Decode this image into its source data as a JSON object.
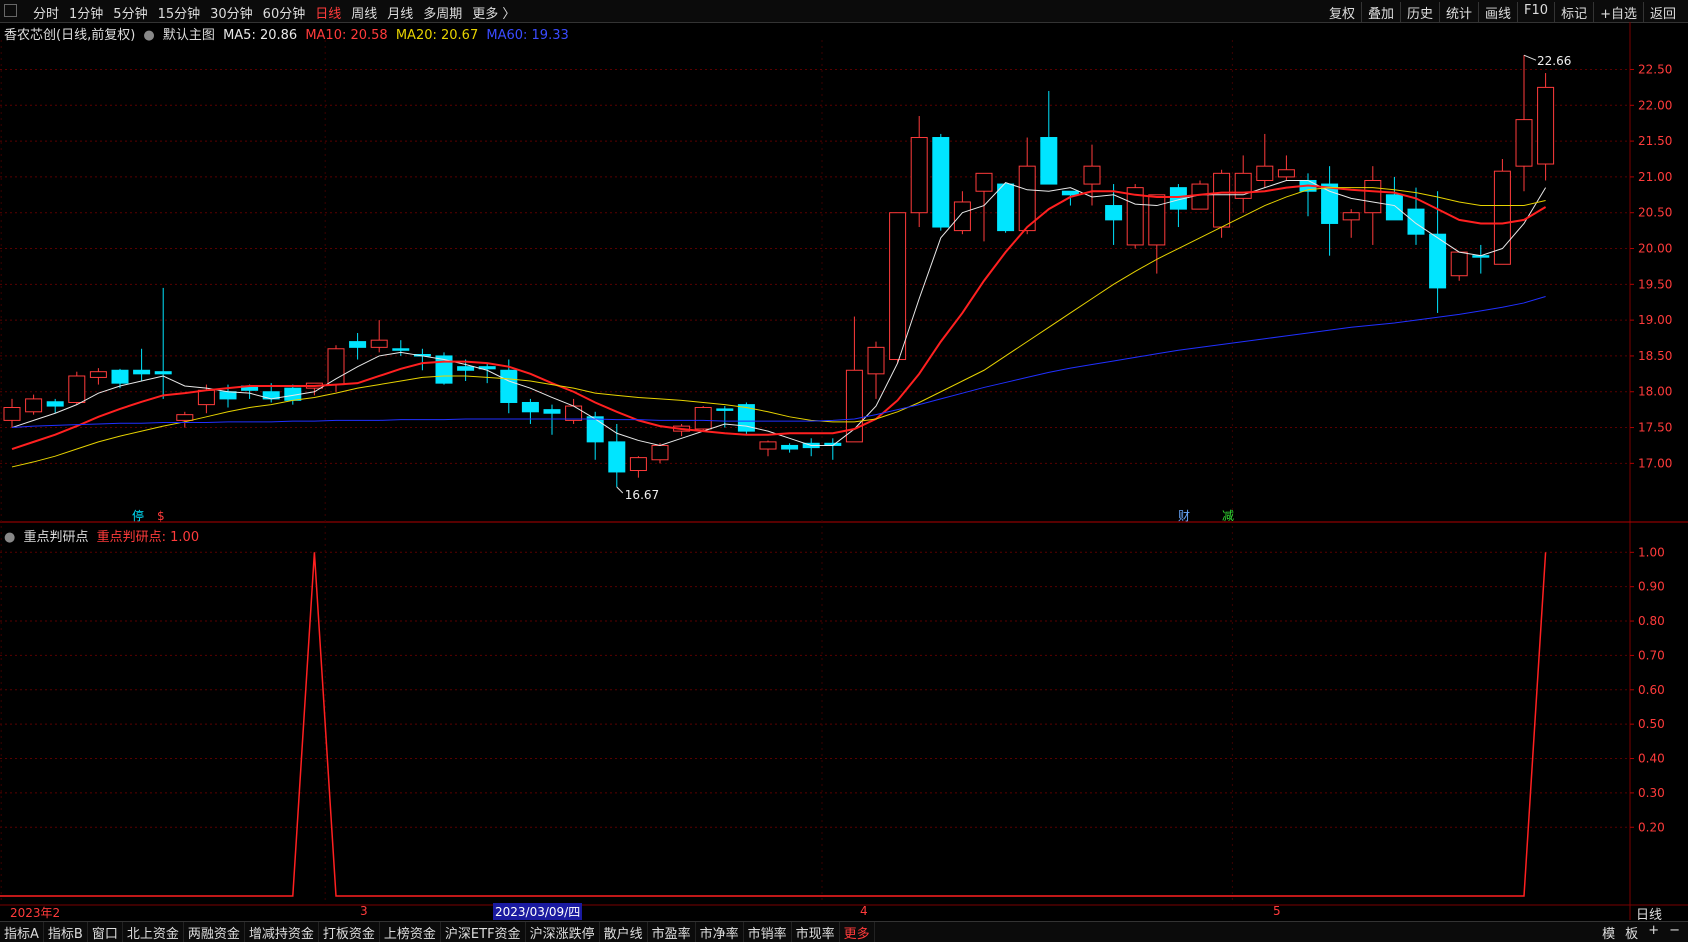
{
  "topbar": {
    "tabs": [
      "分时",
      "1分钟",
      "5分钟",
      "15分钟",
      "30分钟",
      "60分钟",
      "日线",
      "周线",
      "月线",
      "多周期",
      "更多 〉"
    ],
    "active_tab": "日线",
    "right_buttons": [
      "复权",
      "叠加",
      "历史",
      "统计",
      "画线",
      "F10",
      "标记",
      "+自选",
      "返回"
    ]
  },
  "main_legend": {
    "title": "香农芯创(日线,前复权)",
    "template": "默认主图",
    "ma5": "MA5: 20.86",
    "ma10": "MA10: 20.58",
    "ma20": "MA20: 20.67",
    "ma60": "MA60: 19.33"
  },
  "indicator_legend": {
    "name": "重点判研点",
    "value": "重点判研点: 1.00"
  },
  "markers": {
    "high_label": "22.66",
    "low_label": "16.67",
    "event_left_1": "停",
    "event_left_2": "$",
    "event_right_1": "财",
    "event_right_2": "减"
  },
  "xaxis": {
    "labels": [
      "2023年2",
      "3",
      "4",
      "5"
    ],
    "cursor_date": "2023/03/09/四",
    "right_label": "日线"
  },
  "bottombar": {
    "items": [
      "指标A",
      "指标B",
      "窗口",
      "北上资金",
      "两融资金",
      "增减持资金",
      "打板资金",
      "上榜资金",
      "沪深ETF资金",
      "沪深涨跌停",
      "散户线",
      "市盈率",
      "市净率",
      "市销率",
      "市现率",
      "更多"
    ],
    "active": "更多",
    "right": [
      "模",
      "板",
      "+",
      "−"
    ]
  },
  "colors": {
    "up": "#ff3b3b",
    "down": "#00e5ff",
    "ma5": "#e8e8e8",
    "ma10": "#ff2020",
    "ma20": "#e6d200",
    "ma60": "#2030ff",
    "grid": "#5a0000"
  },
  "chart_data": [
    {
      "type": "candlestick",
      "title": "香农芯创(日线,前复权)",
      "ylim": [
        16.6,
        22.8
      ],
      "yticks": [
        "17.00",
        "17.50",
        "18.00",
        "18.50",
        "19.00",
        "19.50",
        "20.00",
        "20.50",
        "21.00",
        "21.50",
        "22.00",
        "22.50"
      ],
      "ohlc": [
        [
          17.6,
          17.9,
          17.5,
          17.78
        ],
        [
          17.72,
          17.96,
          17.68,
          17.9
        ],
        [
          17.86,
          17.9,
          17.7,
          17.8
        ],
        [
          17.85,
          18.28,
          17.82,
          18.22
        ],
        [
          18.2,
          18.33,
          18.1,
          18.28
        ],
        [
          18.3,
          18.32,
          18.05,
          18.12
        ],
        [
          18.3,
          18.6,
          18.15,
          18.25
        ],
        [
          18.28,
          19.45,
          17.9,
          18.25
        ],
        [
          17.6,
          17.72,
          17.5,
          17.68
        ],
        [
          17.82,
          18.1,
          17.7,
          18.02
        ],
        [
          18.0,
          18.1,
          17.78,
          17.9
        ],
        [
          18.08,
          18.1,
          17.9,
          18.02
        ],
        [
          18.0,
          18.12,
          17.85,
          17.9
        ],
        [
          18.05,
          18.1,
          17.82,
          17.88
        ],
        [
          18.05,
          18.12,
          17.95,
          18.12
        ],
        [
          18.1,
          18.65,
          18.0,
          18.6
        ],
        [
          18.7,
          18.82,
          18.45,
          18.62
        ],
        [
          18.62,
          19.0,
          18.55,
          18.72
        ],
        [
          18.6,
          18.72,
          18.5,
          18.58
        ],
        [
          18.52,
          18.6,
          18.3,
          18.5
        ],
        [
          18.5,
          18.55,
          18.1,
          18.12
        ],
        [
          18.35,
          18.45,
          18.15,
          18.3
        ],
        [
          18.35,
          18.4,
          18.12,
          18.32
        ],
        [
          18.3,
          18.45,
          17.7,
          17.85
        ],
        [
          17.85,
          17.9,
          17.55,
          17.72
        ],
        [
          17.75,
          17.82,
          17.4,
          17.7
        ],
        [
          17.6,
          17.9,
          17.55,
          17.8
        ],
        [
          17.65,
          17.72,
          17.05,
          17.3
        ],
        [
          17.3,
          17.55,
          16.67,
          16.88
        ],
        [
          16.9,
          17.1,
          16.8,
          17.08
        ],
        [
          17.05,
          17.28,
          17.0,
          17.25
        ],
        [
          17.45,
          17.55,
          17.38,
          17.52
        ],
        [
          17.48,
          17.8,
          17.45,
          17.78
        ],
        [
          17.76,
          17.8,
          17.5,
          17.75
        ],
        [
          17.82,
          17.85,
          17.4,
          17.45
        ],
        [
          17.2,
          17.32,
          17.1,
          17.3
        ],
        [
          17.25,
          17.28,
          17.15,
          17.2
        ],
        [
          17.28,
          17.35,
          17.1,
          17.22
        ],
        [
          17.28,
          17.35,
          17.05,
          17.25
        ],
        [
          17.3,
          19.05,
          17.3,
          18.3
        ],
        [
          18.25,
          18.7,
          17.9,
          18.62
        ],
        [
          18.45,
          20.5,
          18.4,
          20.5
        ],
        [
          20.5,
          21.85,
          20.3,
          21.55
        ],
        [
          21.55,
          21.6,
          20.25,
          20.3
        ],
        [
          20.25,
          20.8,
          20.2,
          20.65
        ],
        [
          20.8,
          21.05,
          20.1,
          21.05
        ],
        [
          20.9,
          20.92,
          20.22,
          20.25
        ],
        [
          20.25,
          21.55,
          20.2,
          21.15
        ],
        [
          21.55,
          22.2,
          20.9,
          20.9
        ],
        [
          20.8,
          20.8,
          20.6,
          20.75
        ],
        [
          20.9,
          21.45,
          20.6,
          21.15
        ],
        [
          20.6,
          20.9,
          20.05,
          20.4
        ],
        [
          20.05,
          20.9,
          20.0,
          20.85
        ],
        [
          20.05,
          20.75,
          19.65,
          20.75
        ],
        [
          20.85,
          20.9,
          20.3,
          20.55
        ],
        [
          20.55,
          20.95,
          20.6,
          20.9
        ],
        [
          20.3,
          21.1,
          20.15,
          21.05
        ],
        [
          20.7,
          21.3,
          20.5,
          21.05
        ],
        [
          20.95,
          21.6,
          20.85,
          21.15
        ],
        [
          21.0,
          21.3,
          20.95,
          21.1
        ],
        [
          20.95,
          21.05,
          20.45,
          20.8
        ],
        [
          20.9,
          21.15,
          19.9,
          20.35
        ],
        [
          20.4,
          20.55,
          20.15,
          20.5
        ],
        [
          20.5,
          21.15,
          20.05,
          20.95
        ],
        [
          20.75,
          21.0,
          20.45,
          20.4
        ],
        [
          20.55,
          20.85,
          20.05,
          20.2
        ],
        [
          20.2,
          20.8,
          19.1,
          19.45
        ],
        [
          19.62,
          19.95,
          19.55,
          19.95
        ],
        [
          19.9,
          20.05,
          19.65,
          19.88
        ],
        [
          19.78,
          21.25,
          19.78,
          21.08
        ],
        [
          21.15,
          22.7,
          20.8,
          21.8
        ],
        [
          21.18,
          22.45,
          20.95,
          22.25
        ]
      ],
      "series": [
        {
          "name": "MA5",
          "values": [
            17.5,
            17.6,
            17.7,
            17.82,
            17.98,
            18.08,
            18.15,
            18.22,
            18.08,
            18.05,
            18.0,
            17.98,
            17.9,
            17.95,
            18.0,
            18.18,
            18.35,
            18.5,
            18.55,
            18.5,
            18.45,
            18.38,
            18.3,
            18.15,
            18.05,
            17.92,
            17.8,
            17.62,
            17.42,
            17.32,
            17.25,
            17.35,
            17.45,
            17.55,
            17.52,
            17.45,
            17.35,
            17.25,
            17.25,
            17.48,
            17.8,
            18.4,
            19.3,
            20.15,
            20.5,
            20.6,
            20.92,
            20.82,
            20.8,
            20.85,
            20.72,
            20.75,
            20.62,
            20.6,
            20.68,
            20.75,
            20.75,
            20.75,
            20.85,
            20.95,
            20.95,
            20.8,
            20.7,
            20.65,
            20.6,
            20.35,
            20.15,
            19.95,
            19.9,
            20.0,
            20.35,
            20.85
          ]
        },
        {
          "name": "MA10",
          "values": [
            17.2,
            17.3,
            17.4,
            17.52,
            17.65,
            17.76,
            17.86,
            17.95,
            17.98,
            18.02,
            18.05,
            18.08,
            18.08,
            18.08,
            18.08,
            18.1,
            18.12,
            18.22,
            18.32,
            18.4,
            18.42,
            18.42,
            18.4,
            18.35,
            18.25,
            18.12,
            18.0,
            17.85,
            17.72,
            17.6,
            17.52,
            17.48,
            17.45,
            17.42,
            17.4,
            17.4,
            17.42,
            17.42,
            17.42,
            17.48,
            17.62,
            17.88,
            18.25,
            18.7,
            19.1,
            19.55,
            19.95,
            20.3,
            20.55,
            20.72,
            20.8,
            20.8,
            20.75,
            20.72,
            20.72,
            20.75,
            20.78,
            20.78,
            20.8,
            20.85,
            20.88,
            20.85,
            20.82,
            20.8,
            20.78,
            20.7,
            20.55,
            20.4,
            20.35,
            20.35,
            20.4,
            20.58
          ]
        },
        {
          "name": "MA20",
          "values": [
            16.95,
            17.02,
            17.1,
            17.2,
            17.3,
            17.38,
            17.45,
            17.52,
            17.58,
            17.65,
            17.72,
            17.78,
            17.82,
            17.88,
            17.92,
            17.98,
            18.05,
            18.1,
            18.15,
            18.2,
            18.22,
            18.22,
            18.2,
            18.18,
            18.15,
            18.1,
            18.05,
            17.98,
            17.95,
            17.92,
            17.9,
            17.88,
            17.85,
            17.82,
            17.78,
            17.72,
            17.65,
            17.6,
            17.58,
            17.58,
            17.62,
            17.72,
            17.85,
            18.0,
            18.15,
            18.3,
            18.5,
            18.7,
            18.9,
            19.1,
            19.3,
            19.5,
            19.68,
            19.85,
            20.0,
            20.15,
            20.3,
            20.45,
            20.6,
            20.72,
            20.82,
            20.85,
            20.85,
            20.85,
            20.82,
            20.78,
            20.72,
            20.65,
            20.6,
            20.6,
            20.6,
            20.67
          ]
        },
        {
          "name": "MA60",
          "values": [
            17.5,
            17.52,
            17.53,
            17.54,
            17.55,
            17.56,
            17.56,
            17.57,
            17.57,
            17.57,
            17.58,
            17.58,
            17.58,
            17.59,
            17.59,
            17.6,
            17.6,
            17.6,
            17.61,
            17.61,
            17.61,
            17.62,
            17.62,
            17.62,
            17.62,
            17.62,
            17.62,
            17.62,
            17.61,
            17.61,
            17.6,
            17.6,
            17.6,
            17.59,
            17.59,
            17.59,
            17.59,
            17.59,
            17.6,
            17.62,
            17.68,
            17.75,
            17.82,
            17.9,
            17.98,
            18.06,
            18.13,
            18.2,
            18.27,
            18.33,
            18.38,
            18.43,
            18.48,
            18.53,
            18.58,
            18.62,
            18.66,
            18.7,
            18.74,
            18.78,
            18.82,
            18.86,
            18.9,
            18.93,
            18.96,
            19.0,
            19.04,
            19.08,
            19.13,
            19.18,
            19.24,
            19.33
          ]
        }
      ]
    },
    {
      "type": "line",
      "title": "重点判研点",
      "ylim": [
        0.0,
        1.03
      ],
      "yticks": [
        "0.20",
        "0.30",
        "0.40",
        "0.50",
        "0.60",
        "0.70",
        "0.80",
        "0.90",
        "1.00"
      ],
      "series": [
        {
          "name": "重点判研点",
          "values": [
            0,
            0,
            0,
            0,
            0,
            0,
            0,
            0,
            0,
            0,
            0,
            0,
            0,
            0,
            1,
            0,
            0,
            0,
            0,
            0,
            0,
            0,
            0,
            0,
            0,
            0,
            0,
            0,
            0,
            0,
            0,
            0,
            0,
            0,
            0,
            0,
            0,
            0,
            0,
            0,
            0,
            0,
            0,
            0,
            0,
            0,
            0,
            0,
            0,
            0,
            0,
            0,
            0,
            0,
            0,
            0,
            0,
            0,
            0,
            0,
            0,
            0,
            0,
            0,
            0,
            0,
            0,
            0,
            0,
            0,
            0,
            1
          ]
        }
      ]
    }
  ]
}
